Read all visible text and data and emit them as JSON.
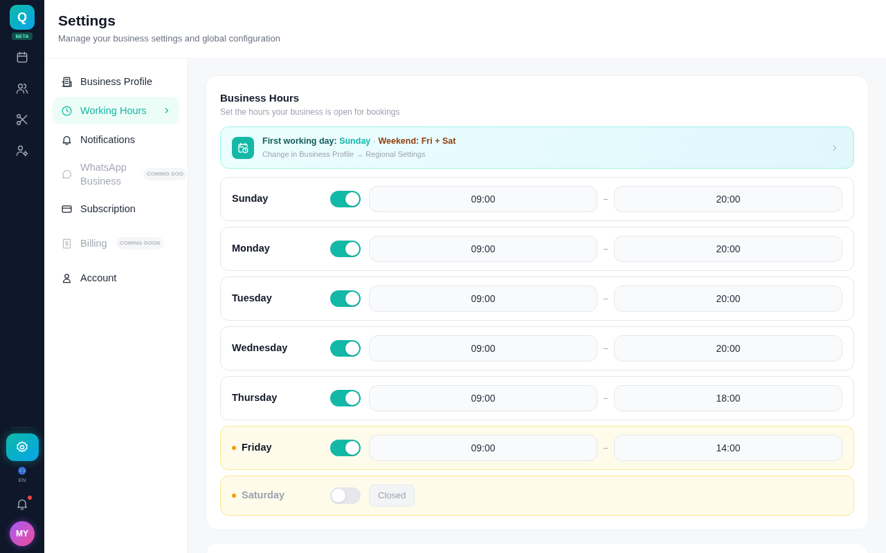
{
  "rail": {
    "logo": "Q",
    "badge": "BETA",
    "items": [
      {
        "kind": "calendar",
        "selected": false
      },
      {
        "kind": "users",
        "selected": false
      },
      {
        "kind": "scissors",
        "selected": false
      },
      {
        "kind": "user-gear",
        "selected": false
      }
    ],
    "settings": {
      "selected": true
    },
    "language": "EN",
    "notifications": {
      "unread": true
    },
    "avatar": "MY"
  },
  "header": {
    "title": "Settings",
    "subtitle": "Manage your business settings and global configuration"
  },
  "nav": [
    {
      "kind": "building",
      "label": "Business Profile",
      "selected": false,
      "disabled": false
    },
    {
      "kind": "clock",
      "label": "Working Hours",
      "selected": true,
      "disabled": false
    },
    {
      "kind": "bell",
      "label": "Notifications",
      "selected": false,
      "disabled": false
    },
    {
      "kind": "chat",
      "label": "WhatsApp Business",
      "selected": false,
      "disabled": true,
      "badge": "COMING SOO"
    },
    {
      "kind": "card",
      "label": "Subscription",
      "selected": false,
      "disabled": false
    },
    {
      "kind": "receipt",
      "label": "Billing",
      "selected": false,
      "disabled": true,
      "badge": "COMING SOON"
    },
    {
      "kind": "user",
      "label": "Account",
      "selected": false,
      "disabled": false
    }
  ],
  "business_hours": {
    "title": "Business Hours",
    "subtitle": "Set the hours your business is open for bookings",
    "banner": {
      "label": "First working day:",
      "value": "Sunday",
      "separator": "·",
      "weekend": "Weekend: Fri + Sat",
      "hint": "Change in Business Profile → Regional Settings"
    },
    "days": [
      {
        "name": "Sunday",
        "on": true,
        "weekend": false,
        "open": "09:00",
        "separator": "–",
        "close": "20:00"
      },
      {
        "name": "Monday",
        "on": true,
        "weekend": false,
        "open": "09:00",
        "separator": "–",
        "close": "20:00"
      },
      {
        "name": "Tuesday",
        "on": true,
        "weekend": false,
        "open": "09:00",
        "separator": "–",
        "close": "20:00"
      },
      {
        "name": "Wednesday",
        "on": true,
        "weekend": false,
        "open": "09:00",
        "separator": "–",
        "close": "20:00"
      },
      {
        "name": "Thursday",
        "on": true,
        "weekend": false,
        "open": "09:00",
        "separator": "–",
        "close": "18:00"
      },
      {
        "name": "Friday",
        "on": true,
        "weekend": true,
        "open": "09:00",
        "separator": "–",
        "close": "14:00"
      },
      {
        "name": "Saturday",
        "on": false,
        "weekend": true,
        "closed_label": "Closed"
      }
    ]
  }
}
